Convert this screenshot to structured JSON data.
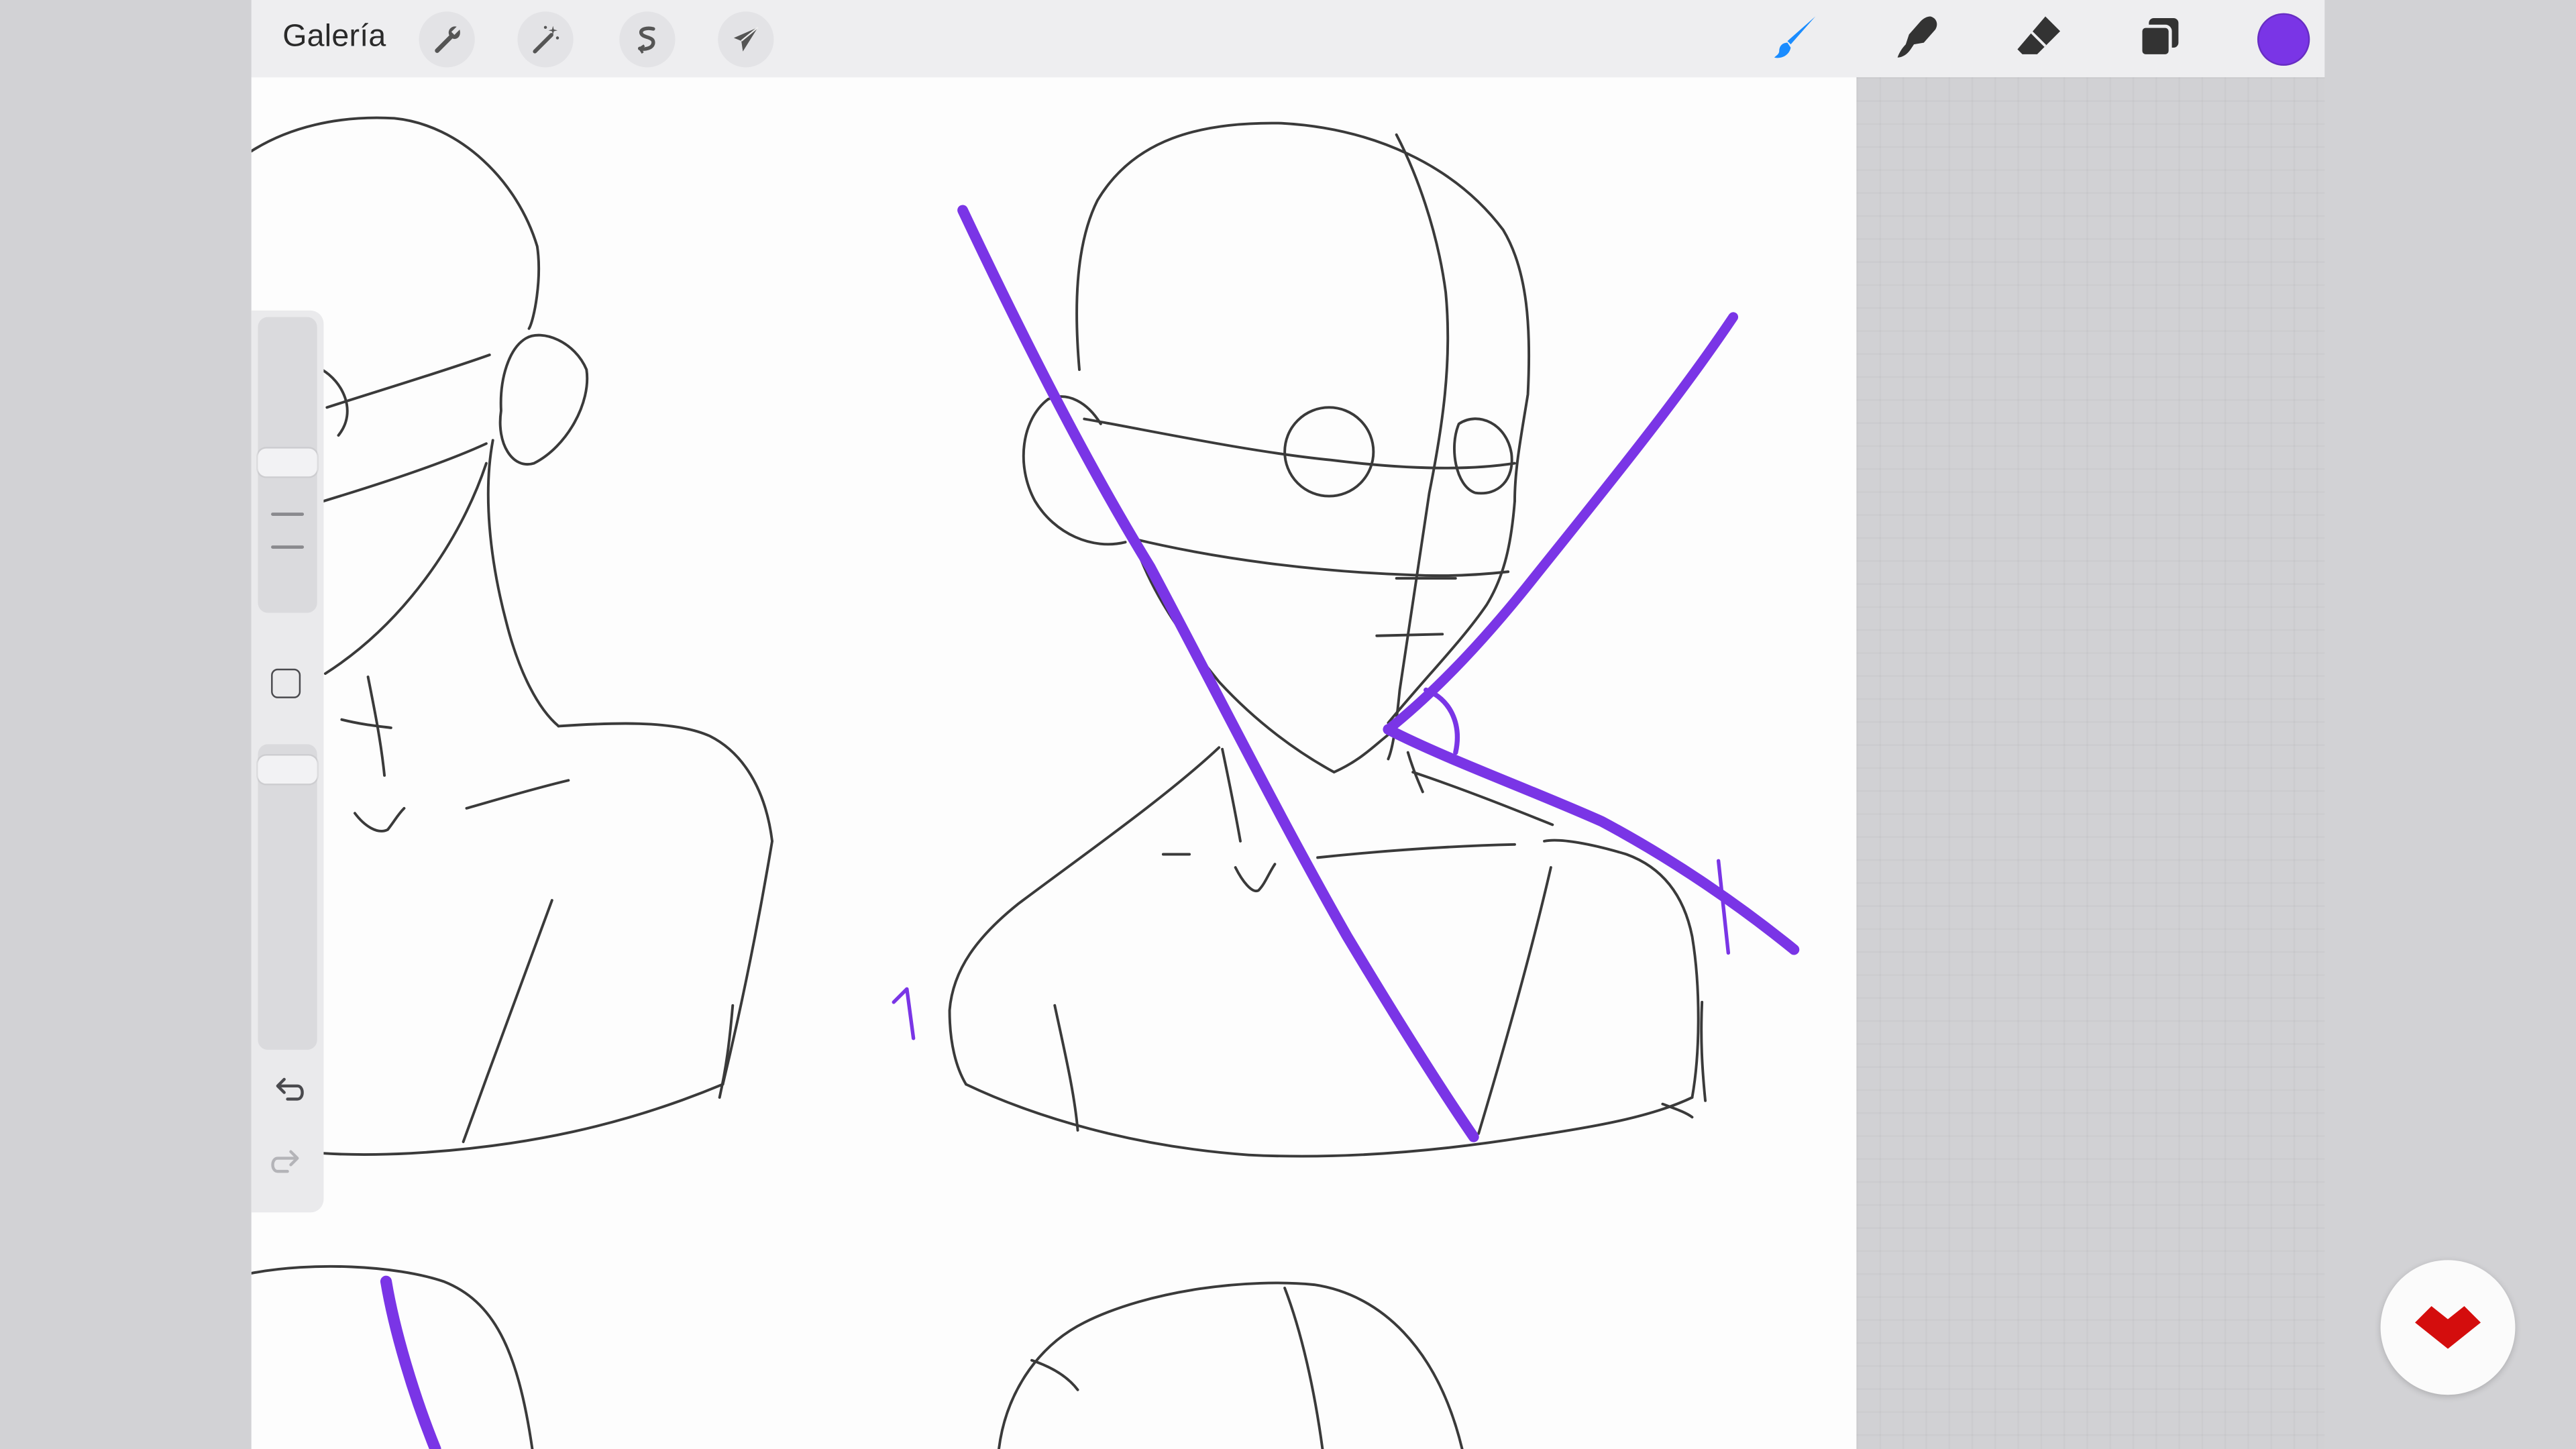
{
  "toolbar": {
    "gallery_label": "Galería",
    "left_tools": [
      {
        "name": "actions",
        "icon": "wrench-icon"
      },
      {
        "name": "adjustments",
        "icon": "magic-wand-icon"
      },
      {
        "name": "selection",
        "icon": "selection-s-icon"
      },
      {
        "name": "transform",
        "icon": "arrow-cursor-icon"
      }
    ],
    "right_tools": [
      {
        "name": "brush",
        "icon": "brush-icon",
        "active": true
      },
      {
        "name": "smudge",
        "icon": "smudge-finger-icon"
      },
      {
        "name": "eraser",
        "icon": "eraser-icon"
      },
      {
        "name": "layers",
        "icon": "layers-icon"
      }
    ],
    "current_color": "#7a35e6",
    "active_tool_color": "#1a8cff"
  },
  "sidebar": {
    "brush_size": "slider",
    "opacity": "slider",
    "modify_icon": "square-icon",
    "undo_icon": "undo-icon",
    "redo_icon": "redo-icon"
  },
  "canvas": {
    "sketch_color": "#3a3a3a",
    "annotation_color": "#7a35e6"
  },
  "watermark": {
    "icon": "brand-logo-icon",
    "color": "#d40d0d"
  }
}
